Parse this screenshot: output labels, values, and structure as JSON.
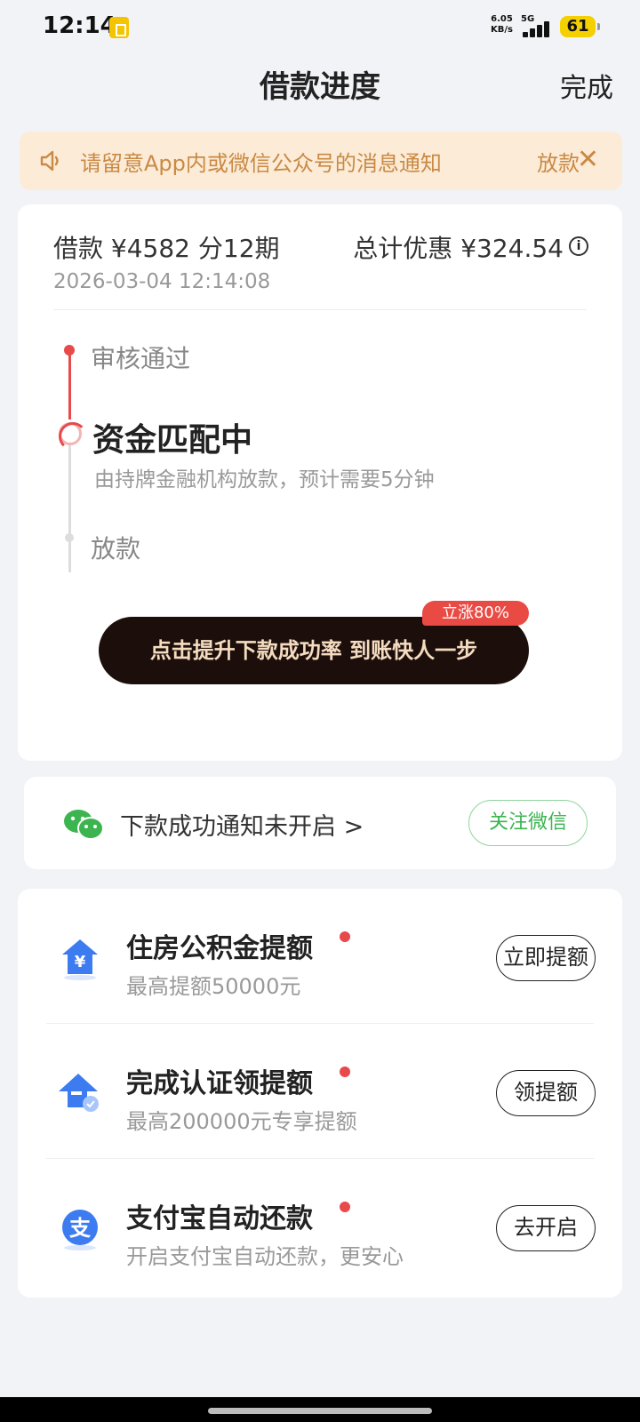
{
  "status_bar": {
    "time": "12:14",
    "net_speed_value": "6.05",
    "net_speed_unit": "KB/s",
    "network": "5G",
    "battery": "61"
  },
  "header": {
    "title": "借款进度",
    "done_label": "完成"
  },
  "notice": {
    "text": "请留意App内或微信公众号的消息通知",
    "overflow_text": "放款",
    "close_label": "✕"
  },
  "loan": {
    "amount": "借款 ¥4582  分12期",
    "discount": "总计优惠 ¥324.54",
    "info_label": "i",
    "time": "2026-03-04 12:14:08"
  },
  "timeline": {
    "steps": [
      {
        "label": "审核通过",
        "state": "done"
      },
      {
        "label": "资金匹配中",
        "state": "active",
        "desc": "由持牌金融机构放款，预计需要5分钟"
      },
      {
        "label": "放款",
        "state": "pending"
      }
    ]
  },
  "boost": {
    "button_label": "点击提升下款成功率 到账快人一步",
    "badge": "立涨80%"
  },
  "wechat": {
    "text": "下款成功通知未开启 >",
    "button_label": "关注微信"
  },
  "items": [
    {
      "title": "住房公积金提额",
      "subtitle": "最高提额50000元",
      "button": "立即提额",
      "icon": "house-yuan-icon"
    },
    {
      "title": "完成认证领提额",
      "subtitle": "最高200000元专享提额",
      "button": "领提额",
      "icon": "arrow-up-verified-icon"
    },
    {
      "title": "支付宝自动还款",
      "subtitle": "开启支付宝自动还款，更安心",
      "button": "去开启",
      "icon": "alipay-icon"
    }
  ],
  "colors": {
    "accent_red": "#e8494a",
    "notice_bg": "#fcebd7",
    "notice_text": "#c98a44",
    "boost_bg": "#1c0f0b",
    "wechat_green": "#3cb551"
  }
}
